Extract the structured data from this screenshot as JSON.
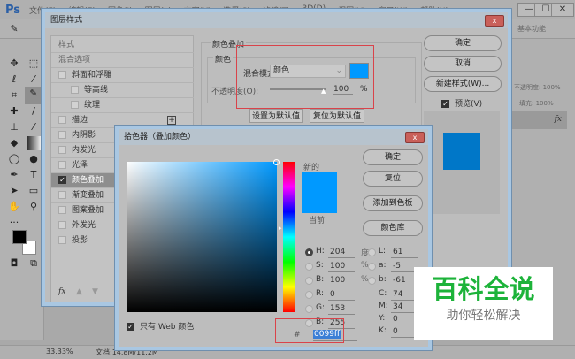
{
  "app": {
    "logo": "Ps",
    "menu": [
      "文件(F)",
      "编辑(E)",
      "图像(I)",
      "图层(L)",
      "文字(Y)",
      "选择(S)",
      "滤镜(T)",
      "3D(D)",
      "视图(V)",
      "窗口(W)",
      "帮助(H)"
    ],
    "window_controls": [
      "—",
      "☐",
      "✕"
    ],
    "workspace": "基本功能"
  },
  "status": {
    "zoom": "33.33%",
    "doc": "文档:14.8M/11.2M"
  },
  "layers_panel": {
    "opacity": "不透明度: 100%",
    "fill": "填充: 100%",
    "fx": "fx"
  },
  "layer_style": {
    "title": "图层样式",
    "close": "x",
    "list": [
      {
        "label": "样式",
        "checkbox": null,
        "indent": 0
      },
      {
        "label": "混合选项",
        "checkbox": null,
        "indent": 0
      },
      {
        "label": "斜面和浮雕",
        "checkbox": false,
        "indent": 0
      },
      {
        "label": "等高线",
        "checkbox": false,
        "indent": 1
      },
      {
        "label": "纹理",
        "checkbox": false,
        "indent": 1
      },
      {
        "label": "描边",
        "checkbox": false,
        "indent": 0,
        "plus": true
      },
      {
        "label": "内阴影",
        "checkbox": false,
        "indent": 0
      },
      {
        "label": "内发光",
        "checkbox": false,
        "indent": 0
      },
      {
        "label": "光泽",
        "checkbox": false,
        "indent": 0
      },
      {
        "label": "颜色叠加",
        "checkbox": true,
        "indent": 0,
        "selected": true
      },
      {
        "label": "渐变叠加",
        "checkbox": false,
        "indent": 0
      },
      {
        "label": "图案叠加",
        "checkbox": false,
        "indent": 0
      },
      {
        "label": "外发光",
        "checkbox": false,
        "indent": 0
      },
      {
        "label": "投影",
        "checkbox": false,
        "indent": 0
      }
    ],
    "fx_label": "fx",
    "section_title": "颜色叠加",
    "group_title": "颜色",
    "blend_mode_label": "混合模式:",
    "blend_mode_value": "颜色",
    "opacity_label": "不透明度(O):",
    "opacity_value": "100",
    "opacity_unit": "%",
    "overlay_color": "#0099ff",
    "set_default": "设置为默认值",
    "reset_default": "复位为默认值",
    "ok": "确定",
    "cancel": "取消",
    "new_style": "新建样式(W)...",
    "preview": "预览(V)",
    "preview_color": "#0077c8"
  },
  "color_picker": {
    "title": "拾色器（叠加颜色）",
    "close": "x",
    "new_label": "新的",
    "current_label": "当前",
    "new_color": "#0099ff",
    "current_color": "#0099ff",
    "ok": "确定",
    "reset": "复位",
    "add_swatch": "添加到色板",
    "libraries": "颜色库",
    "web_only": "只有 Web 颜色",
    "hsb": [
      {
        "k": "H:",
        "v": "204",
        "u": "度",
        "on": true
      },
      {
        "k": "S:",
        "v": "100",
        "u": "%"
      },
      {
        "k": "B:",
        "v": "100",
        "u": "%"
      }
    ],
    "rgb": [
      {
        "k": "R:",
        "v": "0"
      },
      {
        "k": "G:",
        "v": "153"
      },
      {
        "k": "B:",
        "v": "255"
      }
    ],
    "lab": [
      {
        "k": "L:",
        "v": "61"
      },
      {
        "k": "a:",
        "v": "-5"
      },
      {
        "k": "b:",
        "v": "-61"
      }
    ],
    "cmyk": [
      {
        "k": "C:",
        "v": "74"
      },
      {
        "k": "M:",
        "v": "34"
      },
      {
        "k": "Y:",
        "v": "0"
      },
      {
        "k": "K:",
        "v": "0"
      }
    ],
    "hex_label": "#",
    "hex": "0099ff"
  },
  "watermark": {
    "title": "百科全说",
    "subtitle": "助你轻松解决"
  }
}
